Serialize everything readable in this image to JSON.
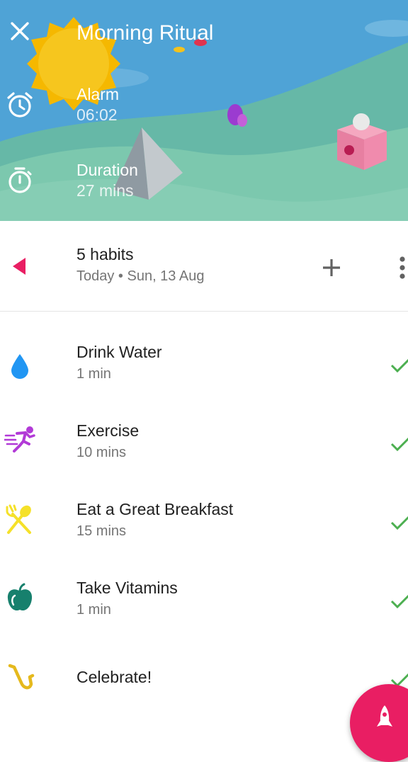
{
  "header": {
    "title": "Morning Ritual",
    "close_icon": "close-icon",
    "alarm": {
      "label": "Alarm",
      "value": "06:02",
      "icon": "alarm-clock-icon"
    },
    "duration": {
      "label": "Duration",
      "value": "27 mins",
      "icon": "stopwatch-icon"
    }
  },
  "summary": {
    "count": "5 habits",
    "date": "Today • Sun, 13 Aug",
    "back_icon": "triangle-left-icon",
    "add_icon": "plus-icon",
    "more_icon": "more-vertical-icon"
  },
  "habits": [
    {
      "name": "Drink Water",
      "duration": "1 min",
      "icon": "water-drop-icon",
      "color": "#2196f3",
      "completed": true
    },
    {
      "name": "Exercise",
      "duration": "10 mins",
      "icon": "running-person-icon",
      "color": "#b23ad7",
      "completed": true
    },
    {
      "name": "Eat a Great Breakfast",
      "duration": "15 mins",
      "icon": "fork-spoon-icon",
      "color": "#f5e12a",
      "completed": true
    },
    {
      "name": "Take Vitamins",
      "duration": "1 min",
      "icon": "apple-icon",
      "color": "#17806d",
      "completed": true
    },
    {
      "name": "Celebrate!",
      "duration": "",
      "icon": "saxophone-icon",
      "color": "#e5b91d",
      "completed": true
    }
  ],
  "fab": {
    "icon": "rocket-icon"
  },
  "colors": {
    "accent": "#e91e63",
    "check": "#4caf50",
    "sky": "#4fa3d6",
    "hills": "#7cc8ae"
  }
}
